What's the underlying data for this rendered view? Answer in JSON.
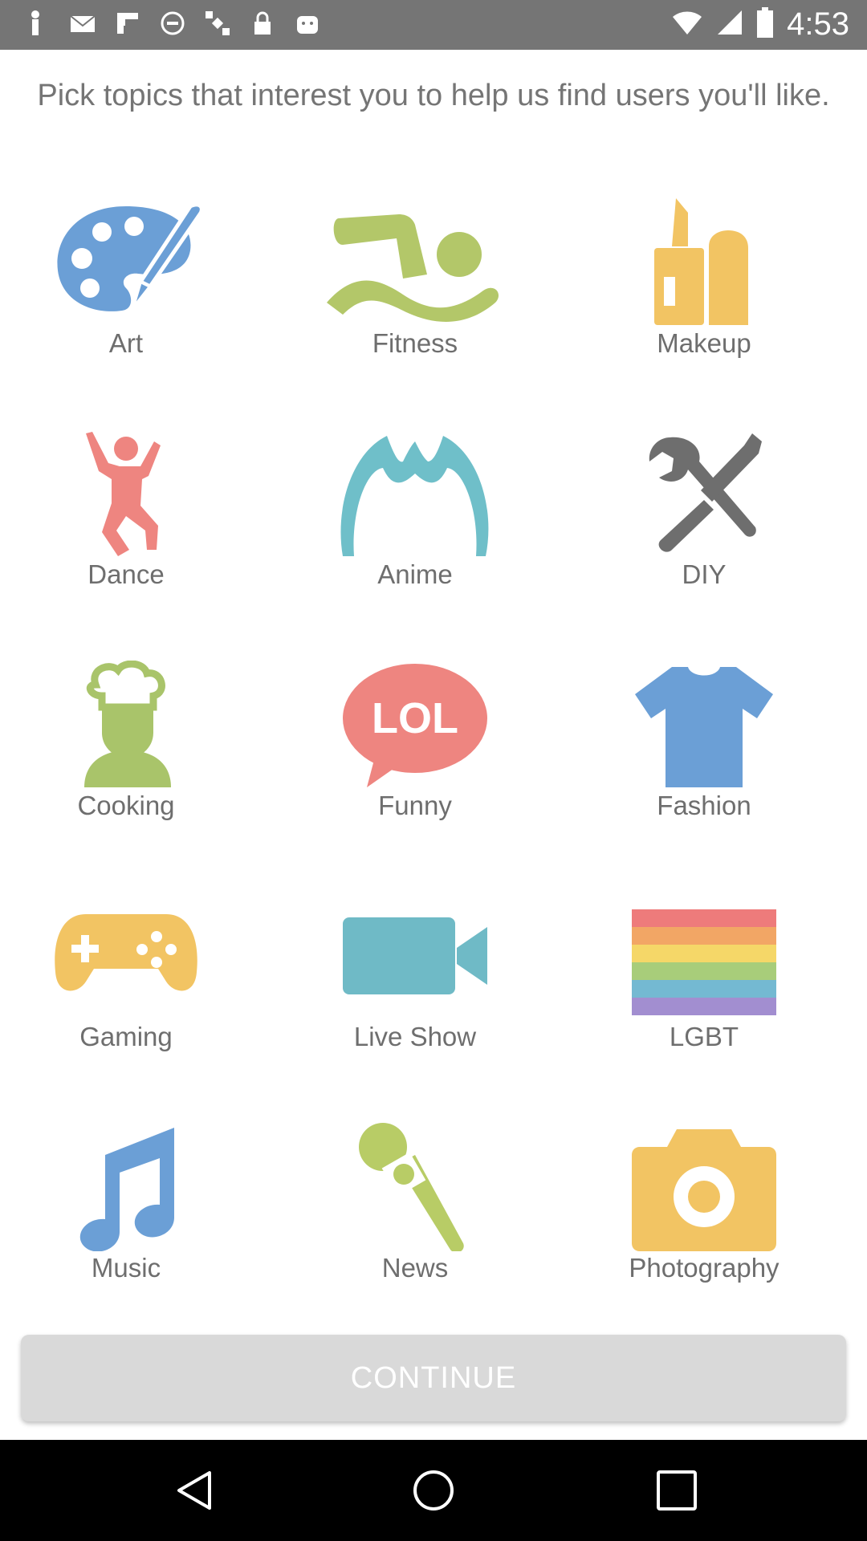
{
  "status_bar": {
    "time": "4:53",
    "icons": [
      "menu-icon",
      "mail-icon",
      "flipboard-icon",
      "block-icon",
      "satellite-icon",
      "lock-icon",
      "android-icon",
      "wifi-icon",
      "signal-icon",
      "battery-icon"
    ]
  },
  "header": {
    "title": "Pick topics that interest you to help us find users you'll like."
  },
  "topics": [
    {
      "label": "Art",
      "icon": "palette-icon",
      "color": "#6b9fd6"
    },
    {
      "label": "Fitness",
      "icon": "swimmer-icon",
      "color": "#b3c769"
    },
    {
      "label": "Makeup",
      "icon": "lipstick-icon",
      "color": "#f2c463"
    },
    {
      "label": "Dance",
      "icon": "dancer-icon",
      "color": "#ee8580"
    },
    {
      "label": "Anime",
      "icon": "anime-hair-icon",
      "color": "#6fbfc9"
    },
    {
      "label": "DIY",
      "icon": "tools-icon",
      "color": "#6e6e6e"
    },
    {
      "label": "Cooking",
      "icon": "chef-icon",
      "color": "#a9c46a"
    },
    {
      "label": "Funny",
      "icon": "lol-bubble-icon",
      "color": "#ee8580",
      "badge": "LOL"
    },
    {
      "label": "Fashion",
      "icon": "tshirt-icon",
      "color": "#6b9fd6"
    },
    {
      "label": "Gaming",
      "icon": "gamepad-icon",
      "color": "#f2c463"
    },
    {
      "label": "Live Show",
      "icon": "video-camera-icon",
      "color": "#6fbac6"
    },
    {
      "label": "LGBT",
      "icon": "rainbow-flag-icon",
      "color": "#ee7b7b"
    },
    {
      "label": "Music",
      "icon": "music-note-icon",
      "color": "#6b9fd6"
    },
    {
      "label": "News",
      "icon": "microphone-icon",
      "color": "#b8cc66"
    },
    {
      "label": "Photography",
      "icon": "camera-icon",
      "color": "#f2c463"
    }
  ],
  "continue_label": "CONTINUE",
  "navbar": {
    "back": "back-icon",
    "home": "home-icon",
    "recents": "recents-icon"
  }
}
